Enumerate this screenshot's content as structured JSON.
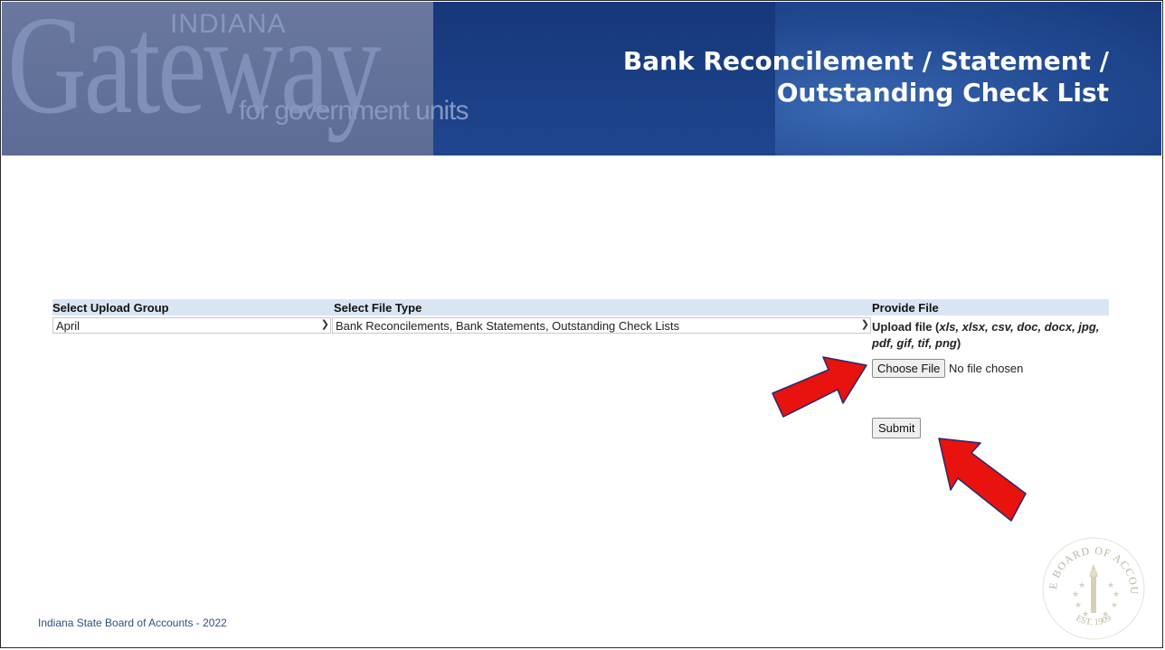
{
  "banner": {
    "logo_indiana": "INDIANA",
    "logo_gateway": "Gateway",
    "logo_tagline": "for government units",
    "title_line1": "Bank Reconcilement / Statement /",
    "title_line2": "Outstanding Check List"
  },
  "upload_form": {
    "headers": {
      "group": "Select Upload Group",
      "file_type": "Select File Type",
      "provide": "Provide File"
    },
    "group_select_value": "April",
    "file_type_select_value": "Bank Reconcilements, Bank Statements, Outstanding Check Lists",
    "provide_label_prefix": "Upload file (",
    "provide_label_types": "xls, xlsx, csv, doc, docx, jpg, pdf, gif, tif, png",
    "provide_label_suffix": ")",
    "choose_file_label": "Choose File",
    "no_file_text": "No file chosen",
    "submit_label": "Submit"
  },
  "footer": {
    "text": "Indiana State Board of Accounts - 2022"
  },
  "seal": {
    "top_text": "STATE BOARD OF ACCOUNTS",
    "bottom_text": "EST. 1909"
  },
  "colors": {
    "arrow": "#e8120f",
    "header_bg": "#d9e5f3",
    "banner_dark": "#1f3f7f",
    "footer_text": "#2f4f7f"
  }
}
